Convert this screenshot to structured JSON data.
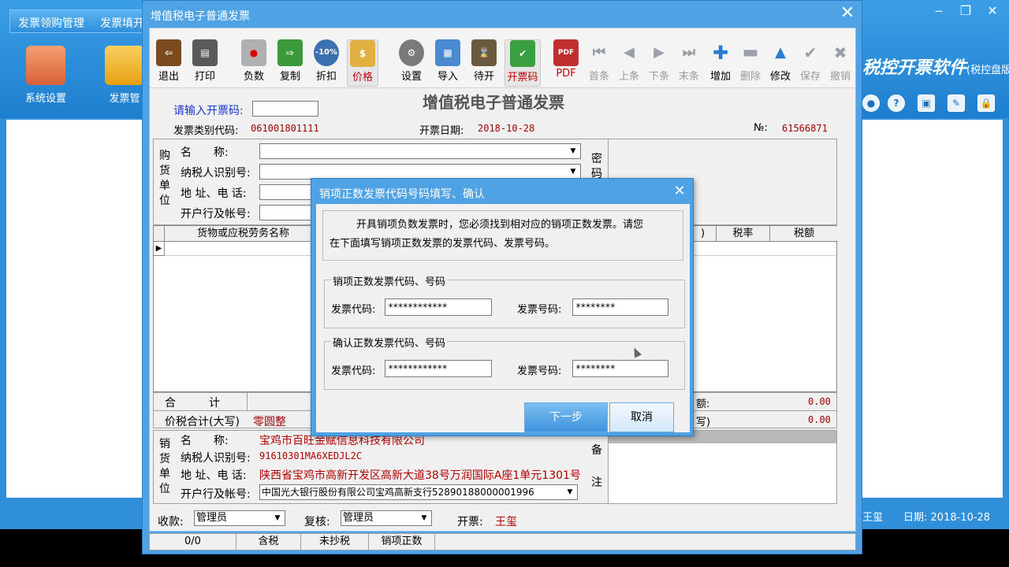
{
  "app": {
    "menu": [
      "发票领购管理",
      "发票填开"
    ],
    "tiles": [
      {
        "label": "系统设置",
        "color": "#e8824a"
      },
      {
        "label": "发票管",
        "color": "#f0b020"
      }
    ],
    "right_title": "税控开票软件",
    "right_title_sub": "(税控盘版)",
    "window_buttons": [
      "‒",
      "❐",
      "✕"
    ],
    "quick_icons": [
      "●",
      "?",
      "▣",
      "✎",
      "🔒"
    ],
    "status_user": "王玺",
    "status_date_label": "日期:",
    "status_date": "2018-10-28"
  },
  "invoice_window": {
    "title": "增值税电子普通发票",
    "close": "✕",
    "toolbar": [
      {
        "id": "exit",
        "label": "退出",
        "icon": "exit-icon",
        "color": "#7a4a20"
      },
      {
        "id": "print",
        "label": "打印",
        "icon": "printer-icon",
        "color": "#555555"
      },
      {
        "id": "negative",
        "label": "负数",
        "icon": "folder-minus-icon",
        "color": "#d04030"
      },
      {
        "id": "copy",
        "label": "复制",
        "icon": "copy-icon",
        "color": "#3a9a3a"
      },
      {
        "id": "discount",
        "label": "折扣",
        "icon": "discount-icon",
        "color": "#3a6fb0",
        "icon_text": "-10%"
      },
      {
        "id": "price",
        "label": "价格",
        "icon": "price-tag-icon",
        "color": "#e0b040"
      },
      {
        "id": "settings",
        "label": "设置",
        "icon": "gear-icon",
        "color": "#7a7a7a"
      },
      {
        "id": "import",
        "label": "导入",
        "icon": "import-grid-icon",
        "color": "#4a8ad0"
      },
      {
        "id": "pending",
        "label": "待开",
        "icon": "hourglass-icon",
        "color": "#6a5a40"
      },
      {
        "id": "issue_code",
        "label": "开票码",
        "icon": "document-check-icon",
        "color": "#3aa040"
      },
      {
        "id": "pdf",
        "label": "PDF",
        "icon": "pdf-icon",
        "color": "#c03030"
      },
      {
        "id": "first",
        "label": "首条",
        "icon": "first-record-icon"
      },
      {
        "id": "prev",
        "label": "上条",
        "icon": "prev-record-icon"
      },
      {
        "id": "next",
        "label": "下条",
        "icon": "next-record-icon"
      },
      {
        "id": "last",
        "label": "末条",
        "icon": "last-record-icon"
      },
      {
        "id": "add",
        "label": "增加",
        "icon": "plus-icon"
      },
      {
        "id": "delete",
        "label": "删除",
        "icon": "minus-icon"
      },
      {
        "id": "modify",
        "label": "修改",
        "icon": "triangle-icon"
      },
      {
        "id": "save",
        "label": "保存",
        "icon": "checkmark-icon"
      },
      {
        "id": "undo",
        "label": "撤销",
        "icon": "cancel-x-icon"
      }
    ],
    "form": {
      "code_prompt": "请输入开票码:",
      "type_code_label": "发票类别代码:",
      "type_code": "061001801111",
      "heading": "增值税电子普通发票",
      "date_label": "开票日期:",
      "date": "2018-10-28",
      "no_label": "№:",
      "no": "61566871"
    },
    "buyer": {
      "side_label": [
        "购",
        "货",
        "单",
        "位"
      ],
      "name_label": "名　　称:",
      "tax_id_label": "纳税人识别号:",
      "addr_label": "地 址、电 话:",
      "bank_label": "开户行及帐号:",
      "secret_label": [
        "密",
        "码"
      ]
    },
    "grid": {
      "headers": [
        "货物或应税劳务名称",
        ")",
        "税率",
        "税额"
      ],
      "row_marker": "▶"
    },
    "totals": {
      "sum_label": "合　　　计",
      "sum_tail_label": "额:",
      "sum_amount": "0.00",
      "total_label": "价税合计(大写)",
      "total_text": "零圆整",
      "total_tail_label": "写)",
      "total_amount": "0.00"
    },
    "seller": {
      "side_label": [
        "销",
        "货",
        "单",
        "位"
      ],
      "name_label": "名　　称:",
      "name": "宝鸡市百旺金赋信息科技有限公司",
      "tax_id_label": "纳税人识别号:",
      "tax_id": "91610301MA6XEDJL2C",
      "addr_label": "地 址、电 话:",
      "addr": "陕西省宝鸡市高新开发区高新大道38号万润国际A座1单元1301号",
      "bank_label": "开户行及帐号:",
      "bank": "中国光大银行股份有限公司宝鸡高新支行52890188000001996",
      "remark_label": [
        "备",
        "注"
      ]
    },
    "signers": {
      "payee_label": "收款:",
      "payee": "管理员",
      "reviewer_label": "复核:",
      "reviewer": "管理员",
      "drawer_label": "开票:",
      "drawer": "王玺"
    },
    "statusbar": [
      "0/0",
      "含税",
      "未抄税",
      "销项正数"
    ]
  },
  "modal": {
    "title": "销项正数发票代码号码填写、确认",
    "close": "✕",
    "message_line1": "开具销项负数发票时，您必须找到相对应的销项正数发票。请您",
    "message_line2": "在下面填写销项正数发票的发票代码、发票号码。",
    "group1_title": "销项正数发票代码、号码",
    "group2_title": "确认正数发票代码、号码",
    "code_label": "发票代码:",
    "number_label": "发票号码:",
    "code_value": "************",
    "number_value": "********",
    "confirm_code_value": "************",
    "confirm_number_value": "********",
    "next_button": "下一步",
    "cancel_button": "取消"
  }
}
